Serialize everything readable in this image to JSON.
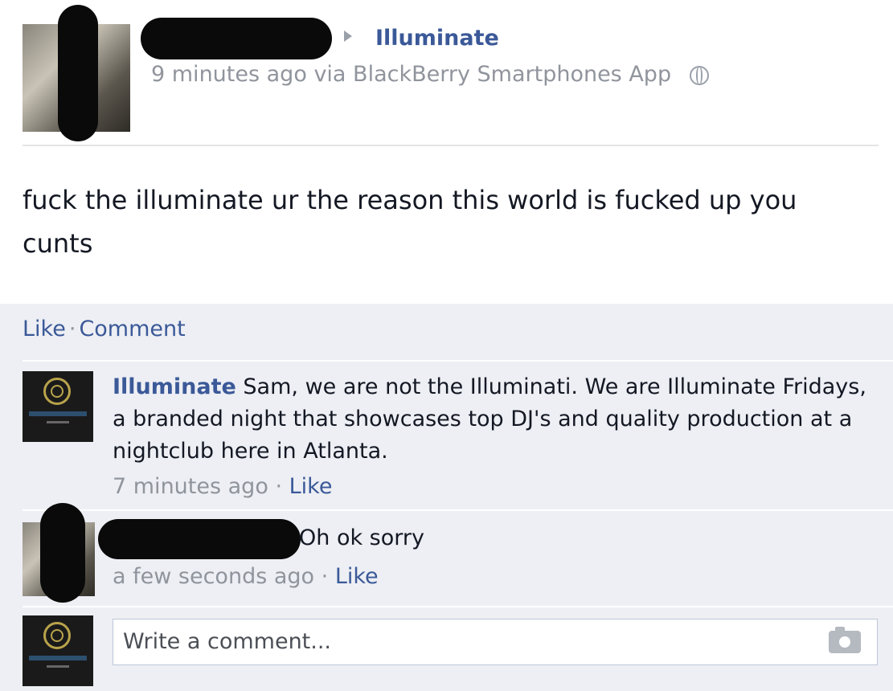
{
  "post": {
    "target_page": "Illuminate",
    "time": "9 minutes ago",
    "via_text": "via BlackBerry Smartphones App",
    "text": "fuck the illuminate ur the reason this world is fucked up you cunts"
  },
  "actions": {
    "like": "Like",
    "separator": "·",
    "comment": "Comment"
  },
  "comments": [
    {
      "author": "Illuminate",
      "text": "Sam, we are not the Illuminati. We are Illuminate Fridays, a branded night that showcases top DJ's and quality production at a nightclub here in Atlanta.",
      "time": "7 minutes ago",
      "like": "Like"
    },
    {
      "author": "",
      "text": "Oh ok sorry",
      "time": "a few seconds ago",
      "like": "Like"
    }
  ],
  "composer": {
    "placeholder": "Write a comment..."
  },
  "icons": {
    "arrow": "triangle-right-icon",
    "privacy": "globe-icon",
    "camera": "camera-icon"
  },
  "colors": {
    "link": "#3b5998",
    "muted": "#90949c",
    "feedback_bg": "#edeff4"
  }
}
